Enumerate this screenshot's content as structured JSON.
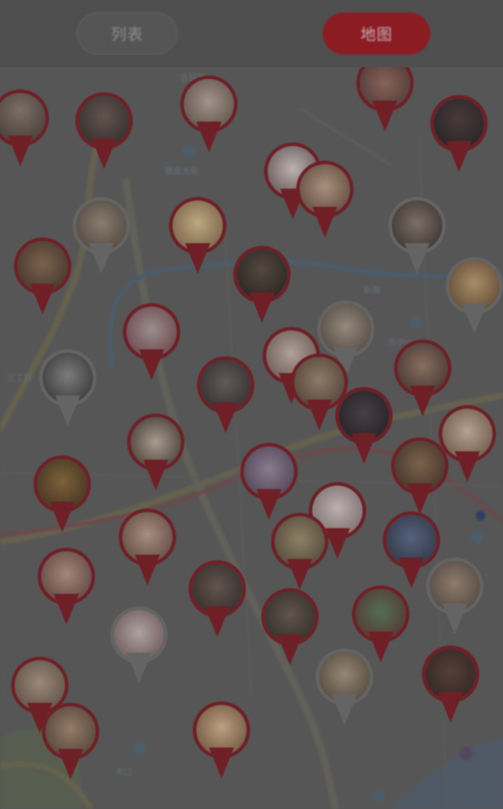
{
  "header": {
    "tab_list_label": "列表",
    "tab_map_label": "地图",
    "accent": "#8b1c24"
  },
  "map": {
    "labels": [
      "吉祥路",
      "银座大街",
      "新宿",
      "市中心",
      "三丁目",
      "东口"
    ],
    "pin_colors": {
      "active": "#7a1a22",
      "inactive": "#6d6d6d"
    },
    "pin_count": 44
  }
}
